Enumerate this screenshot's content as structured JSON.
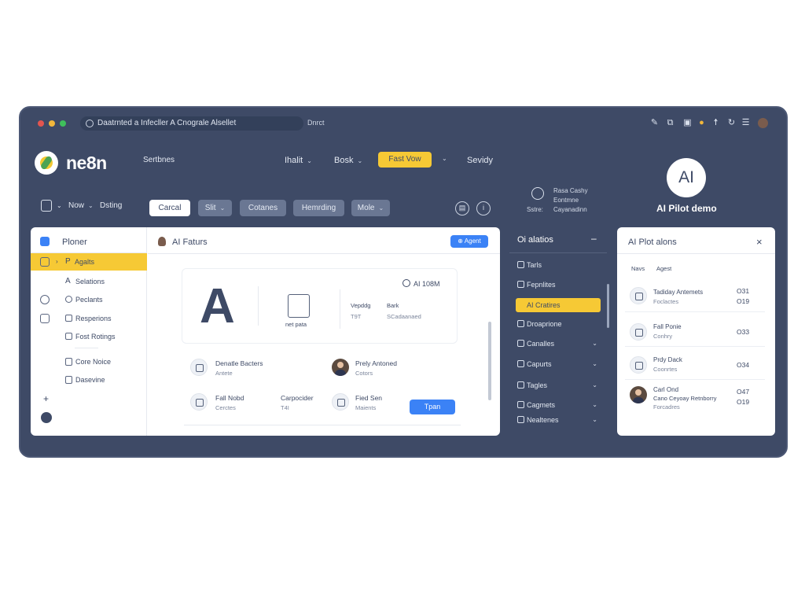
{
  "window": {
    "url": "Daatrnted a Infecller A Cnograle Alsellet",
    "direct": "Dnrct",
    "traffic": {
      "red": "#e2554f",
      "yellow": "#f1b73b",
      "green": "#3fbf5b"
    }
  },
  "header": {
    "brand": "ne8n",
    "settings": "Sertbnes",
    "nav": [
      {
        "label": "Ihalit"
      },
      {
        "label": "Bosk"
      },
      {
        "label": "Fast Vow"
      },
      {
        "label": "Sevidy"
      }
    ],
    "ai_badge": "AI",
    "ai_title": "AI Pilot demo"
  },
  "toolbar": {
    "now": "Now",
    "dating": "Dsting",
    "buttons": [
      "Carcal",
      "Slit",
      "Cotanes",
      "Hemrding",
      "Mole"
    ],
    "status_lines": [
      "Rasa Cashy",
      "Eontmne",
      "Cayanadinn"
    ],
    "status_label": "Sstre:"
  },
  "left_panel": {
    "sidebar_title": "Ploner",
    "sidebar_items": [
      {
        "label": "Agalts",
        "prefix": "P"
      },
      {
        "label": "Selations",
        "prefix": "A"
      },
      {
        "label": "Peclants"
      },
      {
        "label": "Resperions"
      },
      {
        "label": "Fost Rotings"
      },
      {
        "label": "Core Noice"
      },
      {
        "label": "Dasevine"
      }
    ],
    "plus": "+",
    "header_title": "AI Faturs",
    "header_button": "Agent",
    "card": {
      "big_letter": "A",
      "doc_label": "net pata",
      "col1_title": "Vepddg",
      "col1_value": "T9T",
      "col2_title": "Bark",
      "col2_value": "SCadaanaed",
      "meta": "AI 108M"
    },
    "list": [
      {
        "title": "Denatle Bacters",
        "sub": "Antete"
      },
      {
        "title": "Prely Antoned",
        "sub": "Cotors"
      },
      {
        "title": "Fall Nobd",
        "sub": "Cerctes"
      },
      {
        "title": "Carpocider",
        "sub": "T4I"
      },
      {
        "title": "Fied Sen",
        "sub": "Maients"
      }
    ],
    "action_button": "Tpan"
  },
  "middle_panel": {
    "title": "Oi alatios",
    "items": [
      {
        "label": "Tarls"
      },
      {
        "label": "Fepnlites"
      },
      {
        "label": "AI Cratires"
      },
      {
        "label": "Droaprione"
      },
      {
        "label": "Canalles"
      },
      {
        "label": "Capurts"
      },
      {
        "label": "Tagles"
      },
      {
        "label": "Cagmets"
      },
      {
        "label": "Nealtenes"
      }
    ]
  },
  "right_panel": {
    "title": "AI Plot alons",
    "tabs": [
      "Navs",
      "Agest"
    ],
    "rows": [
      {
        "title": "Tadiday Antemets",
        "sub": "Foclactes",
        "n1": "O31",
        "n2": "O19"
      },
      {
        "title": "Fall Ponie",
        "sub": "Conhry",
        "n1": "O33",
        "n2": ""
      },
      {
        "title": "Prdy Dack",
        "sub": "Coonrtes",
        "n1": "O34",
        "n2": ""
      },
      {
        "title": "Carl Ond",
        "sub": "Cano Ceyoay Retnborry",
        "sub2": "Forcadres",
        "n1": "O47",
        "n2": "O19"
      }
    ]
  }
}
